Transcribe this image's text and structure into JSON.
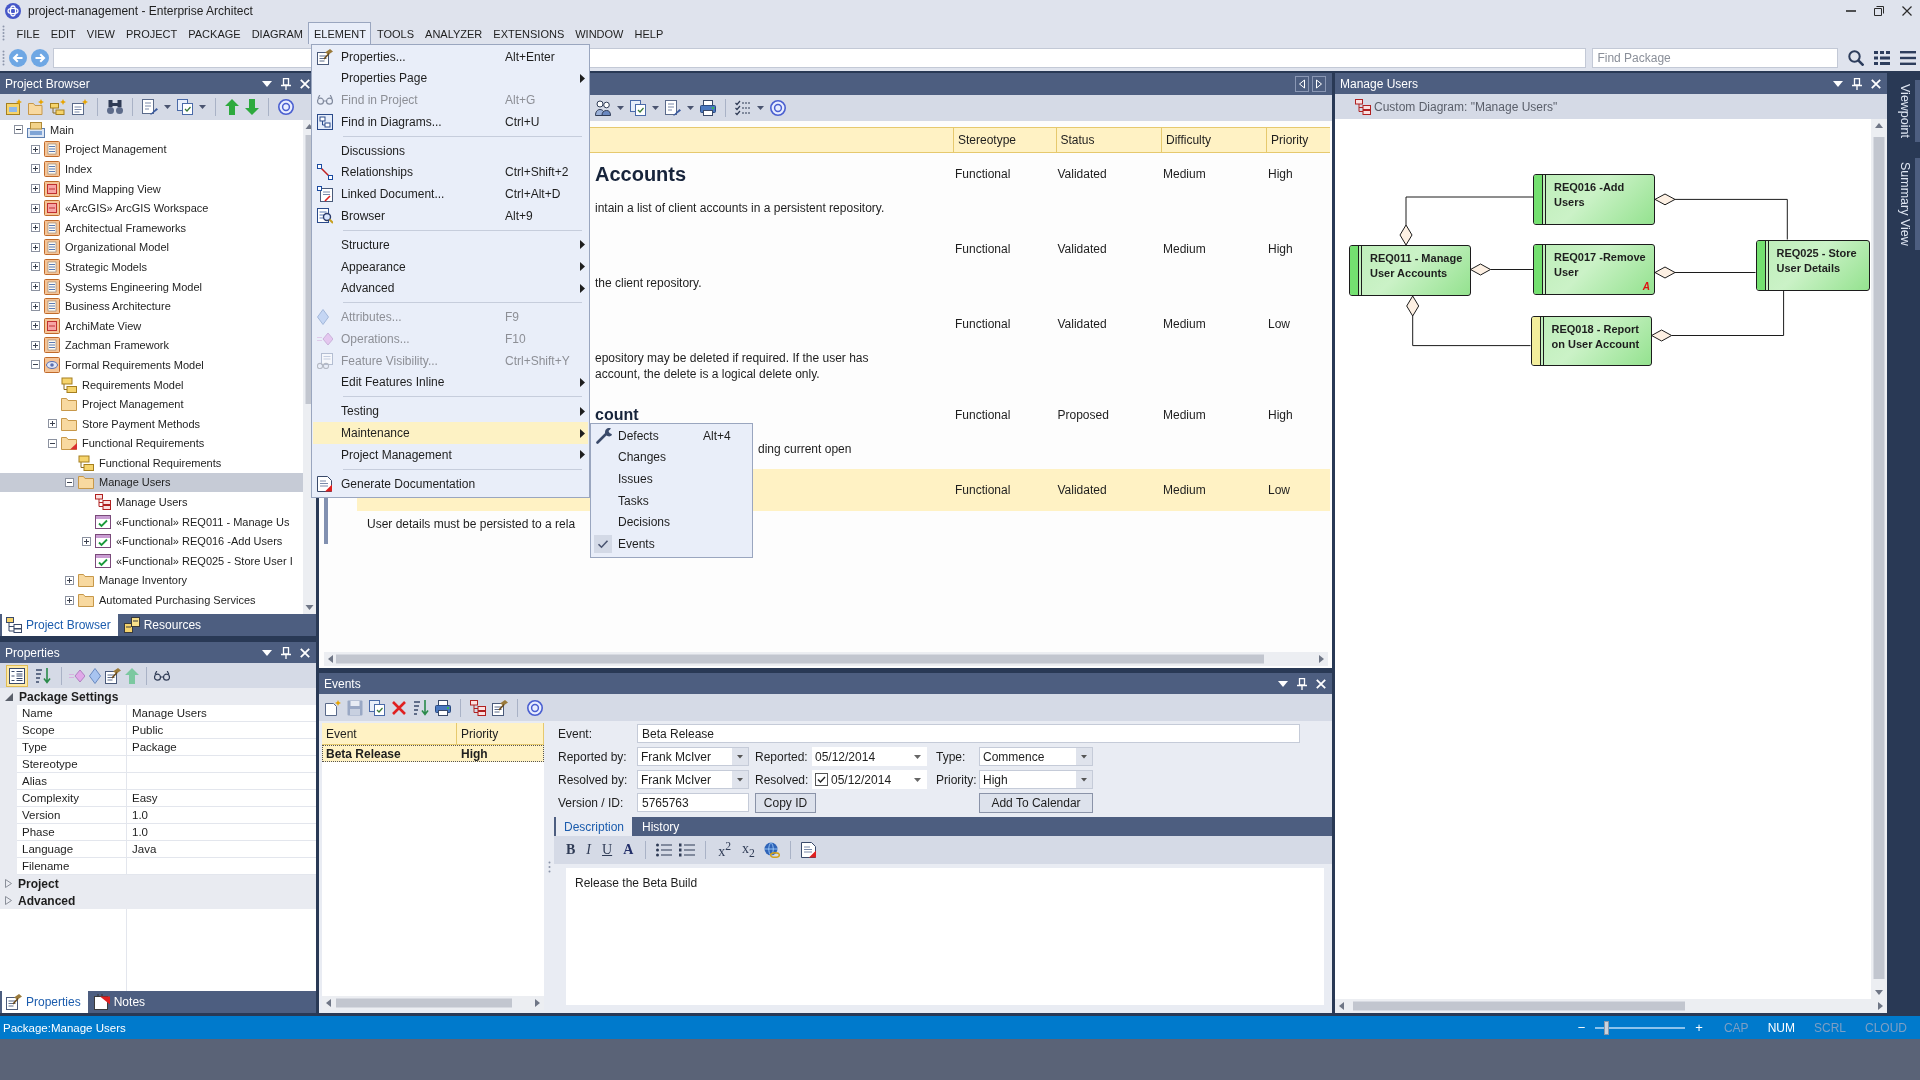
{
  "window": {
    "title": "project-management - Enterprise Architect"
  },
  "menu_bar": [
    {
      "label": "FILE",
      "selected": false
    },
    {
      "label": "EDIT",
      "selected": false
    },
    {
      "label": "VIEW",
      "selected": false
    },
    {
      "label": "PROJECT",
      "selected": false
    },
    {
      "label": "PACKAGE",
      "selected": false
    },
    {
      "label": "DIAGRAM",
      "selected": false
    },
    {
      "label": "ELEMENT",
      "selected": true
    },
    {
      "label": "TOOLS",
      "selected": false
    },
    {
      "label": "ANALYZER",
      "selected": false
    },
    {
      "label": "EXTENSIONS",
      "selected": false
    },
    {
      "label": "WINDOW",
      "selected": false
    },
    {
      "label": "HELP",
      "selected": false
    }
  ],
  "element_menu": {
    "sections": [
      {
        "items": [
          {
            "label": "Properties...",
            "shortcut": "Alt+Enter",
            "submenu": false,
            "disabled": false,
            "selected": false
          },
          {
            "label": "Properties Page",
            "submenu": true,
            "disabled": false,
            "selected": false
          },
          {
            "label": "Find in Project",
            "shortcut": "Alt+G",
            "submenu": false,
            "disabled": true,
            "selected": false
          },
          {
            "label": "Find in Diagrams...",
            "shortcut": "Ctrl+U",
            "submenu": false,
            "disabled": false,
            "selected": false
          }
        ]
      },
      {
        "items": [
          {
            "label": "Discussions",
            "submenu": false,
            "disabled": false,
            "selected": false
          },
          {
            "label": "Relationships",
            "shortcut": "Ctrl+Shift+2",
            "submenu": false,
            "disabled": false,
            "selected": false
          },
          {
            "label": "Linked Document...",
            "shortcut": "Ctrl+Alt+D",
            "submenu": false,
            "disabled": false,
            "selected": false
          },
          {
            "label": "Browser",
            "shortcut": "Alt+9",
            "submenu": false,
            "disabled": false,
            "selected": false
          }
        ]
      },
      {
        "items": [
          {
            "label": "Structure",
            "submenu": true,
            "disabled": false,
            "selected": false
          },
          {
            "label": "Appearance",
            "submenu": true,
            "disabled": false,
            "selected": false
          },
          {
            "label": "Advanced",
            "submenu": true,
            "disabled": false,
            "selected": false
          }
        ]
      },
      {
        "items": [
          {
            "label": "Attributes...",
            "shortcut": "F9",
            "submenu": false,
            "disabled": true,
            "selected": false
          },
          {
            "label": "Operations...",
            "shortcut": "F10",
            "submenu": false,
            "disabled": true,
            "selected": false
          },
          {
            "label": "Feature Visibility...",
            "shortcut": "Ctrl+Shift+Y",
            "submenu": false,
            "disabled": true,
            "selected": false
          },
          {
            "label": "Edit Features Inline",
            "submenu": true,
            "disabled": false,
            "selected": false
          }
        ]
      },
      {
        "items": [
          {
            "label": "Testing",
            "submenu": true,
            "disabled": false,
            "selected": false
          },
          {
            "label": "Maintenance",
            "submenu": true,
            "disabled": false,
            "selected": true
          },
          {
            "label": "Project Management",
            "submenu": true,
            "disabled": false,
            "selected": false
          }
        ]
      },
      {
        "items": [
          {
            "label": "Generate Documentation",
            "submenu": false,
            "disabled": false,
            "selected": false
          }
        ]
      }
    ]
  },
  "maintenance_menu": {
    "items": [
      {
        "label": "Defects",
        "shortcut": "Alt+4",
        "checked": false
      },
      {
        "label": "Changes",
        "checked": false
      },
      {
        "label": "Issues",
        "checked": false
      },
      {
        "label": "Tasks",
        "checked": false
      },
      {
        "label": "Decisions",
        "checked": false
      },
      {
        "label": "Events",
        "checked": true
      }
    ]
  },
  "navigation_bar": {
    "search": {
      "placeholder": "Find Package"
    }
  },
  "project_browser": {
    "title": "Project Browser",
    "tree": [
      {
        "label": "Main",
        "kind": "root",
        "expanded": true,
        "selected": false,
        "children": [
          {
            "label": "Project Management",
            "kind": "model",
            "expanded": false,
            "selected": false
          },
          {
            "label": "Index",
            "kind": "model",
            "expanded": false,
            "selected": false
          },
          {
            "label": "Mind Mapping View",
            "kind": "view",
            "expanded": false,
            "selected": false
          },
          {
            "label": "«ArcGIS» ArcGIS Workspace",
            "kind": "view",
            "expanded": false,
            "selected": false
          },
          {
            "label": "Architectual Frameworks",
            "kind": "model",
            "expanded": false,
            "selected": false
          },
          {
            "label": "Organizational Model",
            "kind": "model",
            "expanded": false,
            "selected": false
          },
          {
            "label": "Strategic Models",
            "kind": "model",
            "expanded": false,
            "selected": false
          },
          {
            "label": "Systems Engineering Model",
            "kind": "model",
            "expanded": false,
            "selected": false
          },
          {
            "label": "Business Architecture",
            "kind": "model",
            "expanded": false,
            "selected": false
          },
          {
            "label": "ArchiMate View",
            "kind": "view",
            "expanded": false,
            "selected": false
          },
          {
            "label": "Zachman Framework",
            "kind": "model",
            "expanded": false,
            "selected": false
          },
          {
            "label": "Formal Requirements Model",
            "kind": "formal_model",
            "expanded": true,
            "selected": false,
            "children": [
              {
                "label": "Requirements Model",
                "kind": "hierarchy",
                "selected": false
              },
              {
                "label": "Project Management",
                "kind": "folder",
                "selected": false
              },
              {
                "label": "Store Payment Methods",
                "kind": "folder",
                "expanded": false,
                "selected": false
              },
              {
                "label": "Functional Requirements",
                "kind": "flagged_folder",
                "expanded": true,
                "selected": false,
                "children": [
                  {
                    "label": "Functional Requirements",
                    "kind": "hierarchy",
                    "selected": false
                  },
                  {
                    "label": "Manage Users",
                    "kind": "folder",
                    "expanded": true,
                    "selected": true,
                    "children": [
                      {
                        "label": "Manage Users",
                        "kind": "diagram",
                        "selected": false
                      },
                      {
                        "label": "«Functional» REQ011 - Manage Us",
                        "kind": "requirement",
                        "selected": false
                      },
                      {
                        "label": "«Functional» REQ016 -Add Users",
                        "kind": "requirement",
                        "expanded": false,
                        "selected": false
                      },
                      {
                        "label": "«Functional» REQ025 - Store User I",
                        "kind": "requirement",
                        "selected": false
                      }
                    ]
                  },
                  {
                    "label": "Manage Inventory",
                    "kind": "folder",
                    "expanded": false,
                    "selected": false
                  },
                  {
                    "label": "Automated Purchasing Services",
                    "kind": "folder",
                    "expanded": false,
                    "selected": false
                  }
                ]
              }
            ]
          }
        ]
      }
    ],
    "tabs": [
      {
        "label": "Project Browser",
        "selected": true
      },
      {
        "label": "Resources",
        "selected": false
      }
    ]
  },
  "properties": {
    "title": "Properties",
    "sort_modes": [
      {
        "selected": true
      },
      {
        "selected": false
      }
    ],
    "groups": [
      {
        "label": "Package Settings",
        "expanded": true,
        "rows": [
          {
            "name": "Name",
            "value": "Manage Users"
          },
          {
            "name": "Scope",
            "value": "Public"
          },
          {
            "name": "Type",
            "value": "Package"
          },
          {
            "name": "Stereotype"
          },
          {
            "name": "Alias"
          },
          {
            "name": "Complexity",
            "value": "Easy"
          },
          {
            "name": "Version",
            "value": "1.0"
          },
          {
            "name": "Phase",
            "value": "1.0"
          },
          {
            "name": "Language",
            "value": "Java"
          },
          {
            "name": "Filename"
          }
        ]
      },
      {
        "label": "Project",
        "expanded": false
      },
      {
        "label": "Advanced",
        "expanded": false
      }
    ],
    "tabs": [
      {
        "label": "Properties",
        "selected": true
      },
      {
        "label": "Notes",
        "selected": false
      }
    ]
  },
  "document": {
    "columns": [
      "Stereotype",
      "Status",
      "Difficulty",
      "Priority"
    ],
    "rows": [
      {
        "heading": "Accounts",
        "notes": [
          "intain a list of client accounts in a persistent repository."
        ],
        "cells": [
          "Functional",
          "Validated",
          "Medium",
          "High"
        ],
        "selected": false
      },
      {
        "notes": [
          "the client repository."
        ],
        "cells": [
          "Functional",
          "Validated",
          "Medium",
          "High"
        ],
        "selected": false
      },
      {
        "notes": [
          "epository may be deleted if required. If the user has",
          "account, the delete is a logical delete only."
        ],
        "cells": [
          "Functional",
          "Validated",
          "Medium",
          "Low"
        ],
        "selected": false
      },
      {
        "subheading": "count",
        "notes": [
          "ding current open"
        ],
        "cells": [
          "Functional",
          "Proposed",
          "Medium",
          "High"
        ],
        "selected": false
      },
      {
        "notes": [
          "User details must be persisted to a rela"
        ],
        "cells": [
          "Functional",
          "Validated",
          "Medium",
          "Low"
        ],
        "selected": true
      }
    ]
  },
  "events": {
    "title": "Events",
    "list": {
      "columns": [
        "Event",
        "Priority"
      ],
      "rows": [
        {
          "cells": [
            "Beta Release",
            "High"
          ],
          "selected": true
        }
      ]
    },
    "form": {
      "event": {
        "label": "Event:",
        "value": "Beta Release"
      },
      "reported_by": {
        "label": "Reported by:",
        "value": "Frank McIver"
      },
      "reported": {
        "label": "Reported:",
        "value": "05/12/2014"
      },
      "type": {
        "label": "Type:",
        "value": "Commence"
      },
      "resolved_by": {
        "label": "Resolved by:",
        "value": "Frank McIver"
      },
      "resolved": {
        "label": "Resolved:",
        "value": "05/12/2014",
        "checked": true
      },
      "priority": {
        "label": "Priority:",
        "value": "High"
      },
      "version": {
        "label": "Version / ID:",
        "value": "5765763"
      },
      "buttons": [
        "Copy ID",
        "Add To Calendar"
      ]
    },
    "tabs": [
      {
        "label": "Description",
        "selected": true
      },
      {
        "label": "History",
        "selected": false
      }
    ],
    "format_buttons": [
      {
        "label": "B",
        "kind": "bold"
      },
      {
        "label": "I",
        "kind": "italic"
      },
      {
        "label": "U",
        "kind": "underline"
      },
      {
        "label": "A",
        "kind": "font_color"
      },
      {
        "label": "x$^{2}$",
        "kind": "superscript"
      },
      {
        "label": "x$_{2}$",
        "kind": "subscript"
      }
    ],
    "description": "Release the Beta Build"
  },
  "diagram": {
    "title": "Manage Users",
    "caption": "Custom Diagram: \"Manage Users\"",
    "nodes": [
      {
        "label": "REQ016 -Add Users",
        "color": "#74e070"
      },
      {
        "label": "REQ011 - Manage User Accounts",
        "color": "#74e070"
      },
      {
        "label": "REQ017 -Remove User",
        "color": "#74e070",
        "badge": "A"
      },
      {
        "label": "REQ025 - Store User Details",
        "color": "#74e070"
      },
      {
        "label": "REQ018 - Report on User Account",
        "color": "#f3ee9c"
      }
    ]
  },
  "side_tabs": [
    {
      "label": "Viewpoint",
      "selected": false
    },
    {
      "label": "Summary View",
      "selected": false
    }
  ],
  "status_bar": {
    "text": "Package:Manage Users",
    "zoom": {
      "out": "−",
      "in": "+",
      "level": 0.1
    },
    "indicators": [
      {
        "label": "CAP",
        "on": false
      },
      {
        "label": "NUM",
        "on": true
      },
      {
        "label": "SCRL",
        "on": false
      },
      {
        "label": "CLOUD",
        "on": false
      }
    ]
  }
}
